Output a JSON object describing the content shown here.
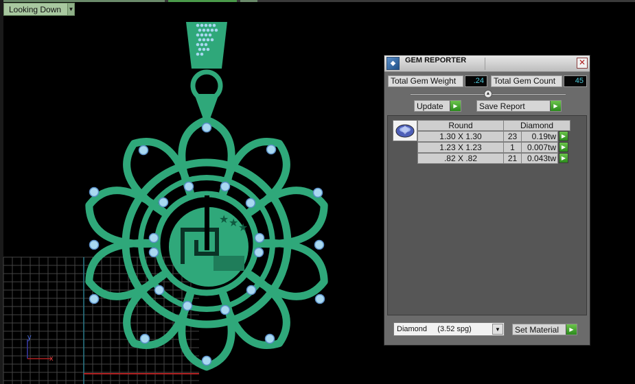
{
  "viewport": {
    "view_label": "Looking Down",
    "axis_y": "y",
    "axis_x": "x",
    "icons": {
      "view_dropdown": "chevron-down-icon"
    }
  },
  "gem_reporter": {
    "title": "GEM REPORTER",
    "total_gem_weight_label": "Total Gem Weight",
    "total_gem_weight": ".24",
    "total_gem_count_label": "Total Gem Count",
    "total_gem_count": "45",
    "update_label": "Update",
    "save_report_label": "Save Report",
    "table": {
      "headers": [
        "Round",
        "Diamond"
      ],
      "rows": [
        {
          "size": "1.30 X 1.30",
          "count": "23",
          "weight": "0.19tw"
        },
        {
          "size": "1.23 X 1.23",
          "count": "1",
          "weight": "0.007tw"
        },
        {
          "size": ".82 X .82",
          "count": "21",
          "weight": "0.043tw"
        }
      ]
    },
    "material_value": "Diamond     (3.52 spg)",
    "set_material_label": "Set Material",
    "colors": {
      "value_text": "#4ecbdc",
      "go_button": "#3aa028",
      "panel": "#6b6b6b"
    },
    "icons": {
      "logo": "gem-reporter-logo-icon",
      "close": "close-icon",
      "go": "play-arrow-icon",
      "gem": "round-gem-icon"
    }
  },
  "design": {
    "colors": {
      "metal": "#2fa87a",
      "gem": "#a8d8f0",
      "grid": "#444444"
    }
  }
}
